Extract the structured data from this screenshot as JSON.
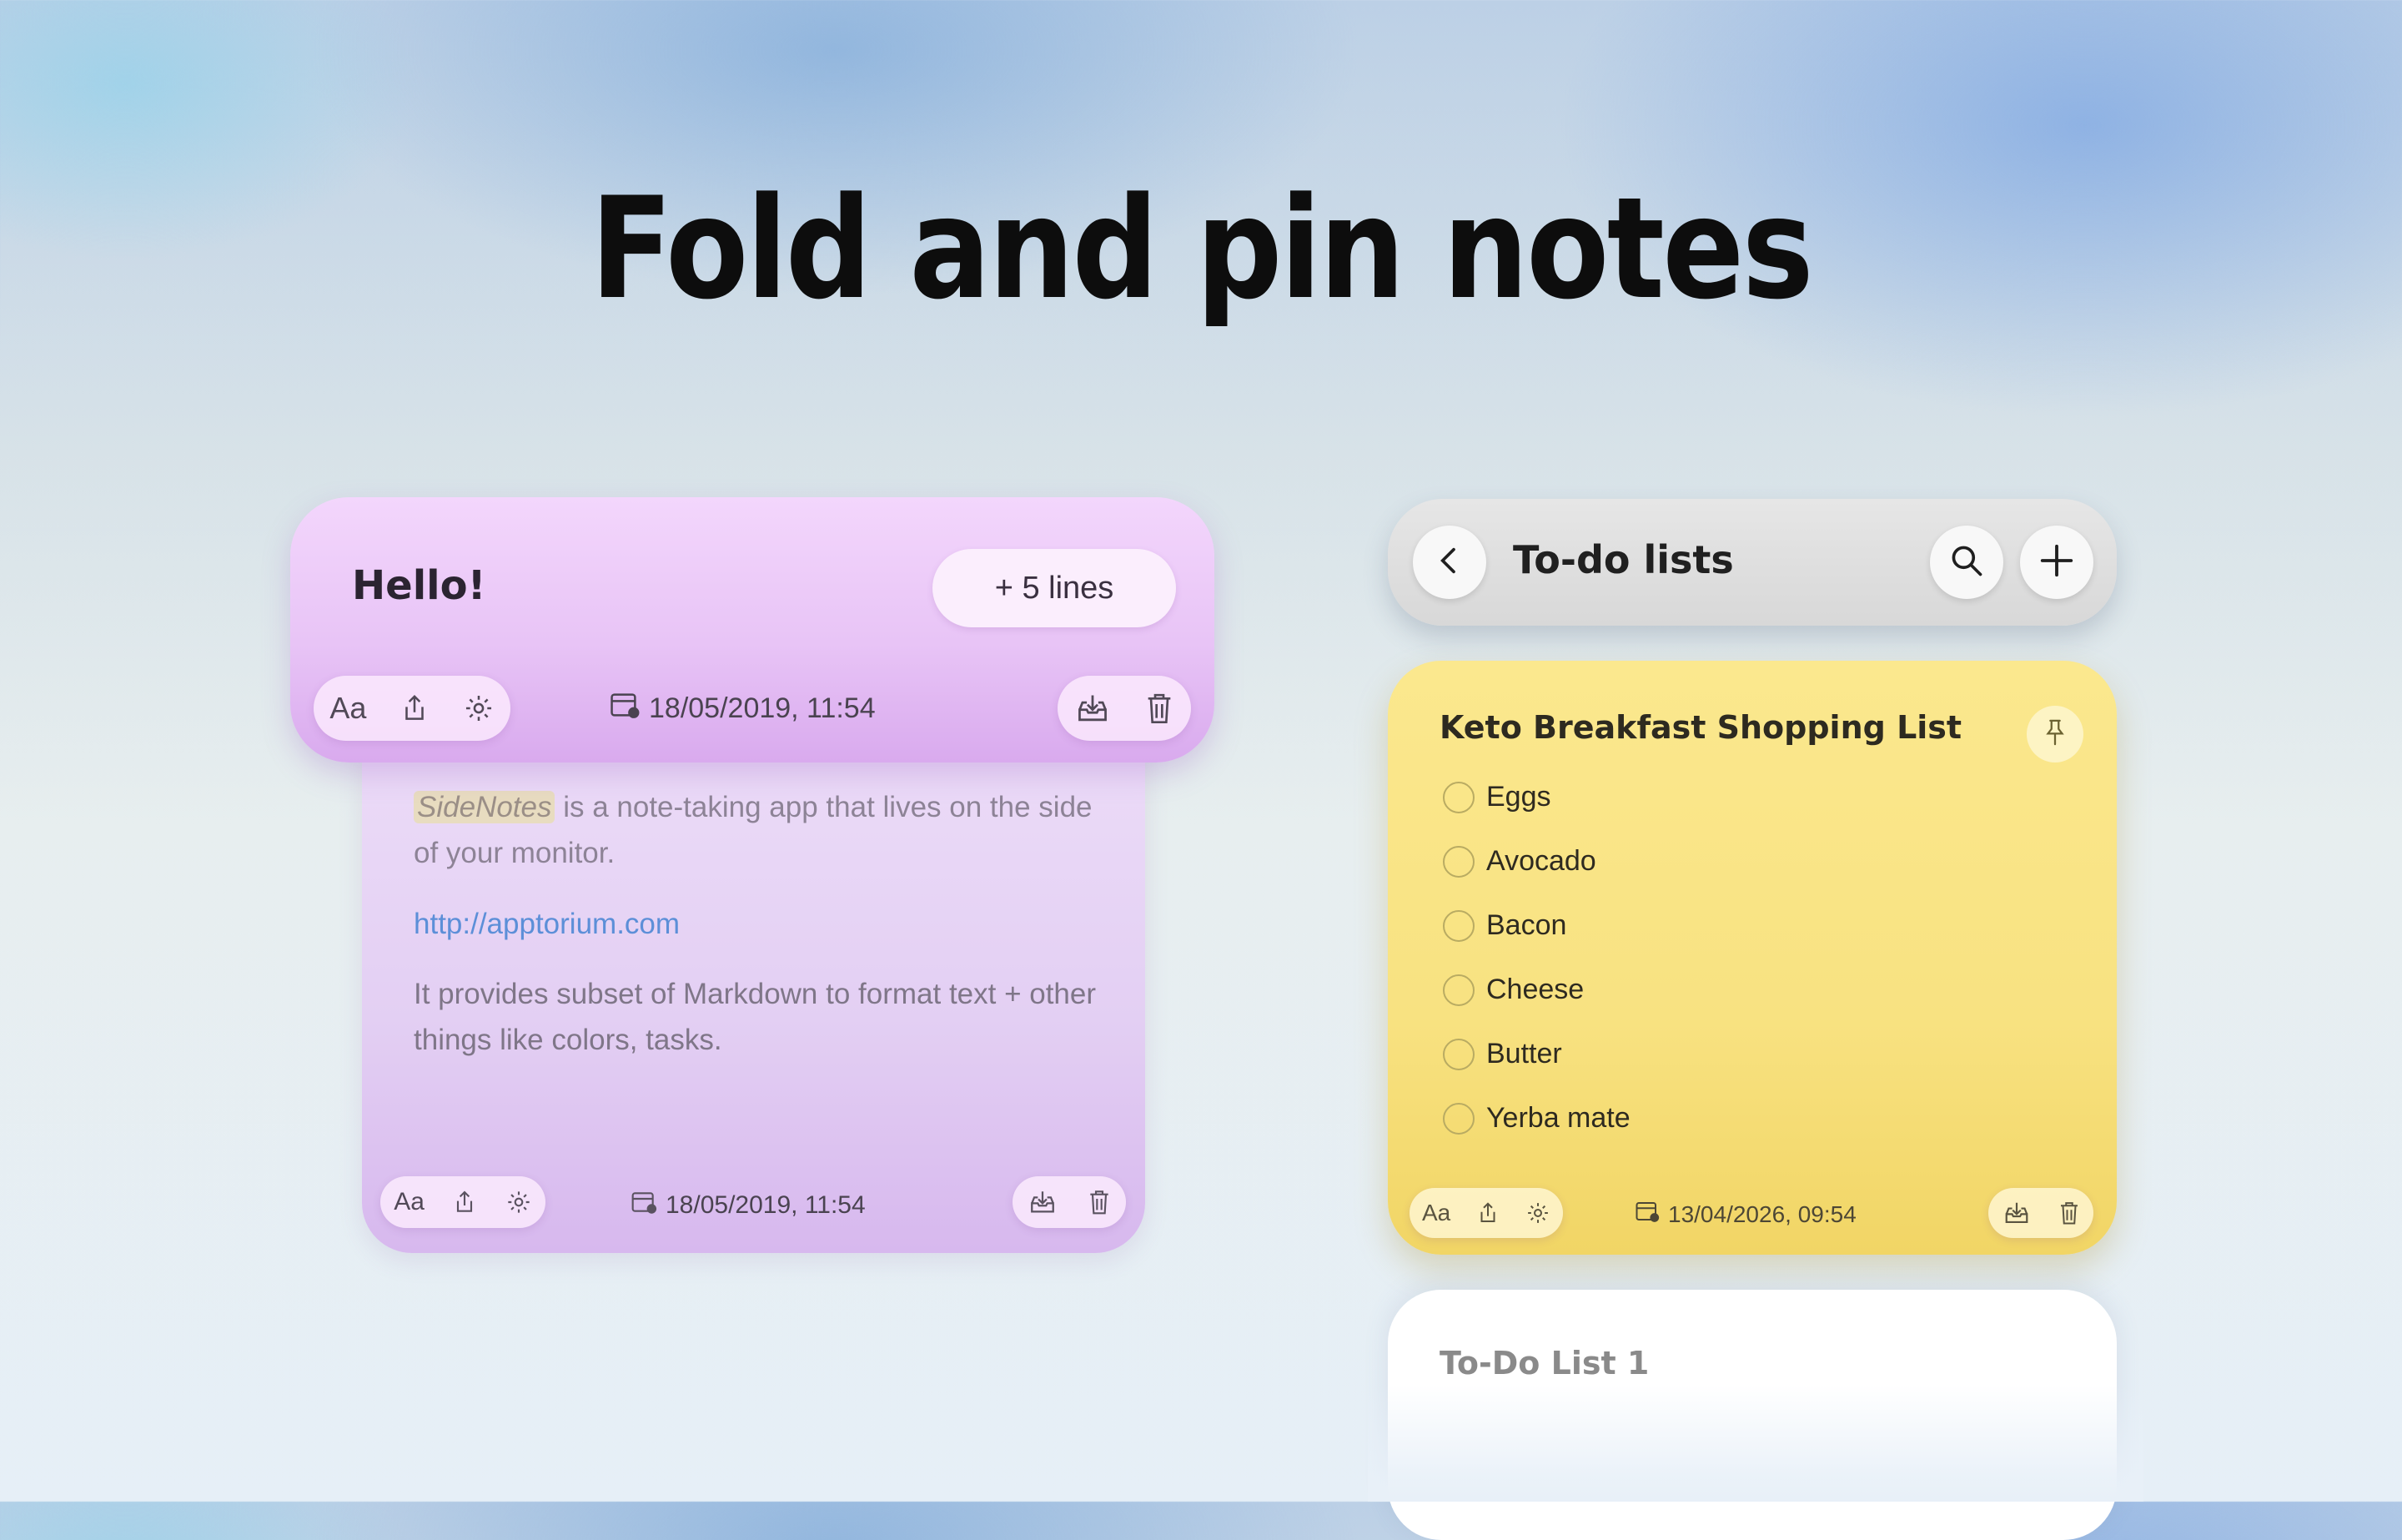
{
  "headline": "Fold and pin notes",
  "folded_note": {
    "title": "Hello!",
    "fold_badge": "+ 5 lines",
    "font_button": "Aa",
    "date": "18/05/2019, 11:54",
    "body": {
      "highlight": "SideNotes",
      "intro_rest": " is a note-taking app that lives on the side of your monitor.",
      "link": "http://apptorium.com",
      "paragraph": "It provides subset of Markdown to format text + other things like colors, tasks."
    },
    "footer_font_button": "Aa",
    "footer_date": "18/05/2019, 11:54"
  },
  "todo_panel": {
    "header_title": "To-do lists",
    "pinned_card": {
      "title": "Keto Breakfast Shopping List",
      "items": [
        "Eggs",
        "Avocado",
        "Bacon",
        "Cheese",
        "Butter",
        "Yerba mate"
      ],
      "font_button": "Aa",
      "date": "13/04/2026, 09:54"
    },
    "next_card": {
      "title": "To-Do List 1"
    }
  },
  "colors": {
    "purple_note": "#e8c4f6",
    "yellow_note": "#f8e281",
    "link": "#5c8fd8"
  },
  "icons": [
    "share-icon",
    "gear-icon",
    "calendar-icon",
    "archive-icon",
    "trash-icon",
    "chevron-left-icon",
    "search-icon",
    "plus-icon",
    "pin-icon"
  ]
}
